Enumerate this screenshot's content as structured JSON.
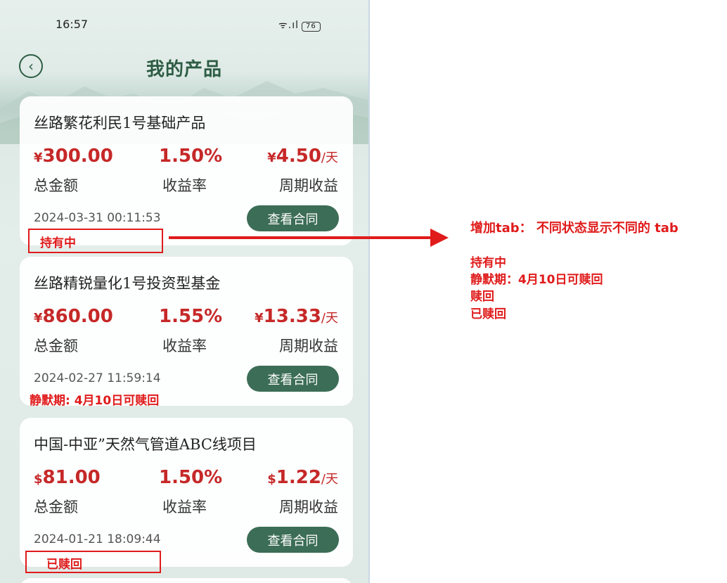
{
  "status_bar": {
    "time": "16:57",
    "signal": "ᯤ.ıl",
    "battery": "76"
  },
  "header": {
    "title": "我的产品"
  },
  "labels": {
    "total": "总金额",
    "rate": "收益率",
    "period": "周期收益",
    "view_contract": "查看合同",
    "per_day": "/天"
  },
  "products": [
    {
      "name": "丝路繁花利民1号基础产品",
      "currency": "¥",
      "amount": "300.00",
      "rate": "1.50%",
      "period_currency": "¥",
      "period_income": "4.50",
      "date": "2024-03-31 00:11:53",
      "status": "持有中"
    },
    {
      "name": "丝路精锐量化1号投资型基金",
      "currency": "¥",
      "amount": "860.00",
      "rate": "1.55%",
      "period_currency": "¥",
      "period_income": "13.33",
      "date": "2024-02-27 11:59:14",
      "status": "静默期: 4月10日可赎回"
    },
    {
      "name": "中国-中亚”天然气管道ABC线项目",
      "currency": "$",
      "amount": "81.00",
      "rate": "1.50%",
      "period_currency": "$",
      "period_income": "1.22",
      "date": "2024-01-21 18:09:44",
      "status": "已赎回"
    }
  ],
  "annotation": {
    "heading": "增加tab：  不同状态显示不同的 tab",
    "lines": [
      "持有中",
      "静默期：4月10日可赎回",
      "赎回",
      "已赎回"
    ]
  },
  "colors": {
    "accent_green": "#3c6d56",
    "title_green": "#2d5c44",
    "highlight_red": "#c62828",
    "annotation_red": "#e01b1b"
  }
}
